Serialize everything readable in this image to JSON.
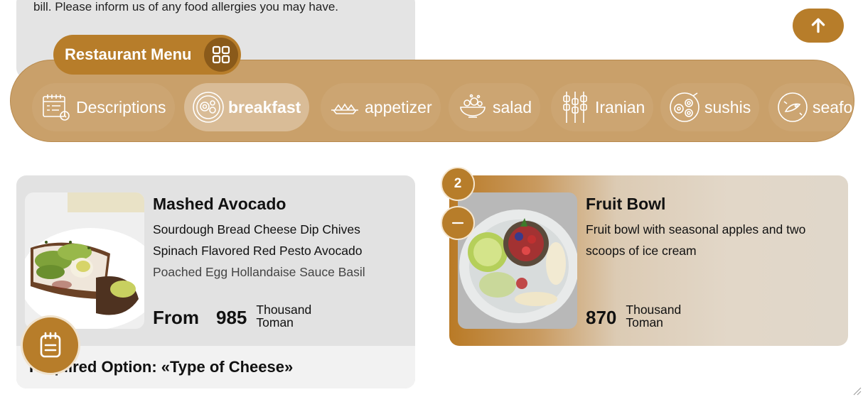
{
  "info": {
    "text": "bill. Please inform us of any food allergies you may have."
  },
  "header": {
    "title": "Restaurant Menu"
  },
  "categories": [
    {
      "label": "Descriptions",
      "icon": "menu-calendar-icon",
      "active": false
    },
    {
      "label": "breakfast",
      "icon": "breakfast-plate-icon",
      "active": true
    },
    {
      "label": "appetizer",
      "icon": "appetizer-dish-icon",
      "active": false
    },
    {
      "label": "salad",
      "icon": "salad-bowl-icon",
      "active": false
    },
    {
      "label": "Iranian",
      "icon": "kebab-skewers-icon",
      "active": false
    },
    {
      "label": "sushis",
      "icon": "sushi-icon",
      "active": false
    },
    {
      "label": "seafo",
      "icon": "seafood-icon",
      "active": false
    }
  ],
  "items": [
    {
      "name": "Mashed Avocado",
      "desc_lines": [
        "Sourdough Bread Cheese Dip Chives",
        "Spinach Flavored Red Pesto Avocado",
        "Poached Egg Hollandaise Sauce Basil"
      ],
      "price_prefix": "From",
      "price": "985",
      "unit_line1": "Thousand",
      "unit_line2": "Toman",
      "required_option": "Required Option: «Type of Cheese»"
    },
    {
      "name": "Fruit Bowl",
      "desc_lines": [
        "Fruit bowl with seasonal apples and two",
        "scoops of ice cream"
      ],
      "price": "870",
      "unit_line1": "Thousand",
      "unit_line2": "Toman",
      "quantity": "2"
    }
  ],
  "colors": {
    "accent": "#b77d2a",
    "menu_bar": "#c9a06a",
    "card_bg": "#e2e2e2"
  }
}
